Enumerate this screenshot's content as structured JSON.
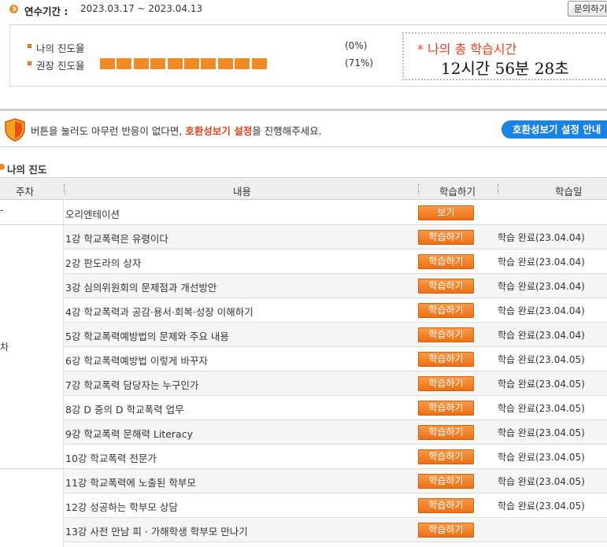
{
  "period": {
    "label": "연수기간 :",
    "value": "2023.03.17 ~ 2023.04.13",
    "inquiry_button": "문의하기"
  },
  "progress": {
    "my_label": "나의 진도율",
    "my_pct": "(0%)",
    "my_value_percent": 0,
    "recommended_label": "권장 진도율",
    "recommended_pct": "(71%)",
    "recommended_value_percent": 71,
    "total_time_title": "* 나의 총 학습시간",
    "total_time_value": "12시간 56분 28초"
  },
  "notice": {
    "text_before": "버튼을 눌러도 아무런 반응이 없다면, ",
    "text_emphasis": "호환성보기 설정",
    "text_after": "을 진행해주세요.",
    "guide_button": "호환성보기 설정 안내"
  },
  "section": {
    "title": "나의 진도"
  },
  "table": {
    "headers": {
      "week": "주차",
      "content": "내용",
      "action": "학습하기",
      "date": "학습일"
    },
    "weeks": [
      "-",
      "차"
    ],
    "rows": [
      {
        "content": "오리엔테이션",
        "button": "보기",
        "date": ""
      },
      {
        "content": "1강 학교폭력은 유령이다",
        "button": "학습하기",
        "date": "학습 완료(23.04.04)"
      },
      {
        "content": "2강 판도라의 상자",
        "button": "학습하기",
        "date": "학습 완료(23.04.04)"
      },
      {
        "content": "3강 심의위원회의 문제점과 개선방안",
        "button": "학습하기",
        "date": "학습 완료(23.04.04)"
      },
      {
        "content": "4강 학교폭력과 공감·용서·회복·성장 이해하기",
        "button": "학습하기",
        "date": "학습 완료(23.04.04)"
      },
      {
        "content": "5강 학교폭력예방법의 문제와 주요 내용",
        "button": "학습하기",
        "date": "학습 완료(23.04.04)"
      },
      {
        "content": "6강 학교폭력예방법 이렇게 바꾸자",
        "button": "학습하기",
        "date": "학습 완료(23.04.05)"
      },
      {
        "content": "7강 학교폭력 담당자는 누구인가",
        "button": "학습하기",
        "date": "학습 완료(23.04.05)"
      },
      {
        "content": "8강 D 중의 D 학교폭력 업무",
        "button": "학습하기",
        "date": "학습 완료(23.04.05)"
      },
      {
        "content": "9강 학교폭력 문해력 Literacy",
        "button": "학습하기",
        "date": "학습 완료(23.04.05)"
      },
      {
        "content": "10강 학교폭력 전문가",
        "button": "학습하기",
        "date": "학습 완료(23.04.05)"
      },
      {
        "content": "11강 학교폭력에 노출된 학부모",
        "button": "학습하기",
        "date": "학습 완료(23.04.05)"
      },
      {
        "content": "12강 성공하는 학부모 상담",
        "button": "학습하기",
        "date": "학습 완료(23.04.05)"
      },
      {
        "content": "13강 사전 만남 피 · 가해학생 학부모 만나기",
        "button": "학습하기",
        "date": ""
      }
    ]
  },
  "colors": {
    "accent": "#f08a24",
    "emphasis": "#e8421c",
    "guide_button": "#1a82e2"
  }
}
